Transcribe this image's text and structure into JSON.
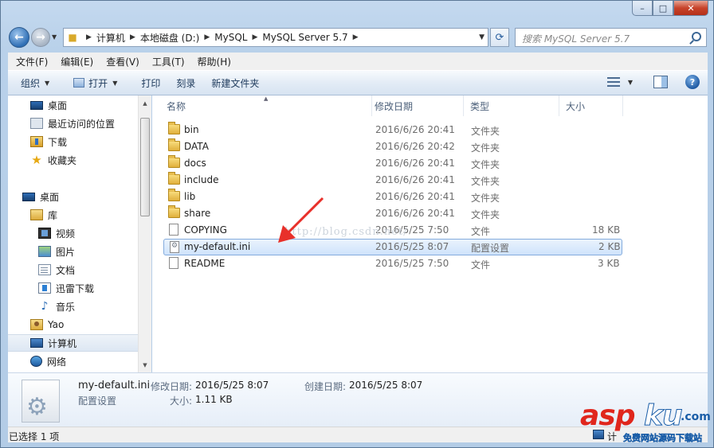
{
  "window": {
    "caption": {
      "minimize": "–",
      "maximize": "□",
      "close": "✕"
    }
  },
  "address": {
    "crumbs": [
      "计算机",
      "本地磁盘 (D:)",
      "MySQL",
      "MySQL Server 5.7"
    ],
    "search_placeholder": "搜索 MySQL Server 5.7"
  },
  "menu": [
    "文件(F)",
    "编辑(E)",
    "查看(V)",
    "工具(T)",
    "帮助(H)"
  ],
  "commands": {
    "organize": "组织",
    "open": "打开",
    "print": "打印",
    "burn": "刻录",
    "new_folder": "新建文件夹"
  },
  "nav": {
    "items": [
      {
        "label": "桌面",
        "icon": "desktop-icon"
      },
      {
        "label": "最近访问的位置",
        "icon": "recent-places-icon"
      },
      {
        "label": "下载",
        "icon": "downloads-icon"
      },
      {
        "label": "收藏夹",
        "icon": "favorites-star-icon"
      },
      {
        "label": "桌面",
        "icon": "desktop-icon"
      },
      {
        "label": "库",
        "icon": "libraries-icon"
      },
      {
        "label": "视频",
        "icon": "videos-icon"
      },
      {
        "label": "图片",
        "icon": "pictures-icon"
      },
      {
        "label": "文档",
        "icon": "documents-icon"
      },
      {
        "label": "迅雷下载",
        "icon": "thunder-download-icon"
      },
      {
        "label": "音乐",
        "icon": "music-icon"
      },
      {
        "label": "Yao",
        "icon": "user-folder-icon"
      },
      {
        "label": "计算机",
        "icon": "computer-icon"
      },
      {
        "label": "网络",
        "icon": "network-icon"
      }
    ],
    "selected_index": 12
  },
  "columns": {
    "name": "名称",
    "modified": "修改日期",
    "type": "类型",
    "size": "大小"
  },
  "files": [
    {
      "name": "bin",
      "modified": "2016/6/26 20:41",
      "type": "文件夹",
      "size": "",
      "kind": "folder"
    },
    {
      "name": "DATA",
      "modified": "2016/6/26 20:42",
      "type": "文件夹",
      "size": "",
      "kind": "folder"
    },
    {
      "name": "docs",
      "modified": "2016/6/26 20:41",
      "type": "文件夹",
      "size": "",
      "kind": "folder"
    },
    {
      "name": "include",
      "modified": "2016/6/26 20:41",
      "type": "文件夹",
      "size": "",
      "kind": "folder"
    },
    {
      "name": "lib",
      "modified": "2016/6/26 20:41",
      "type": "文件夹",
      "size": "",
      "kind": "folder"
    },
    {
      "name": "share",
      "modified": "2016/6/26 20:41",
      "type": "文件夹",
      "size": "",
      "kind": "folder"
    },
    {
      "name": "COPYING",
      "modified": "2016/5/25 7:50",
      "type": "文件",
      "size": "18 KB",
      "kind": "file"
    },
    {
      "name": "my-default.ini",
      "modified": "2016/5/25 8:07",
      "type": "配置设置",
      "size": "2 KB",
      "kind": "ini"
    },
    {
      "name": "README",
      "modified": "2016/5/25 7:50",
      "type": "文件",
      "size": "3 KB",
      "kind": "file"
    }
  ],
  "selected_file_index": 7,
  "watermark_url": "http://blog.csdn.net/",
  "details": {
    "name": "my-default.ini",
    "type": "配置设置",
    "modified_label": "修改日期:",
    "modified_value": "2016/5/25 8:07",
    "created_label": "创建日期:",
    "created_value": "2016/5/25 8:07",
    "size_label": "大小:",
    "size_value": "1.11 KB"
  },
  "status": {
    "left": "已选择 1 项",
    "right": "计"
  },
  "logo": {
    "asp": "asp",
    "ku": "ku",
    "dotcom": ".com",
    "tagline": "免费网站源码下载站"
  },
  "colors": {
    "selection_border": "#84acdd",
    "arrow": "#e8302a",
    "logo_red": "#e0261c",
    "logo_blue": "#1b5ea8"
  }
}
